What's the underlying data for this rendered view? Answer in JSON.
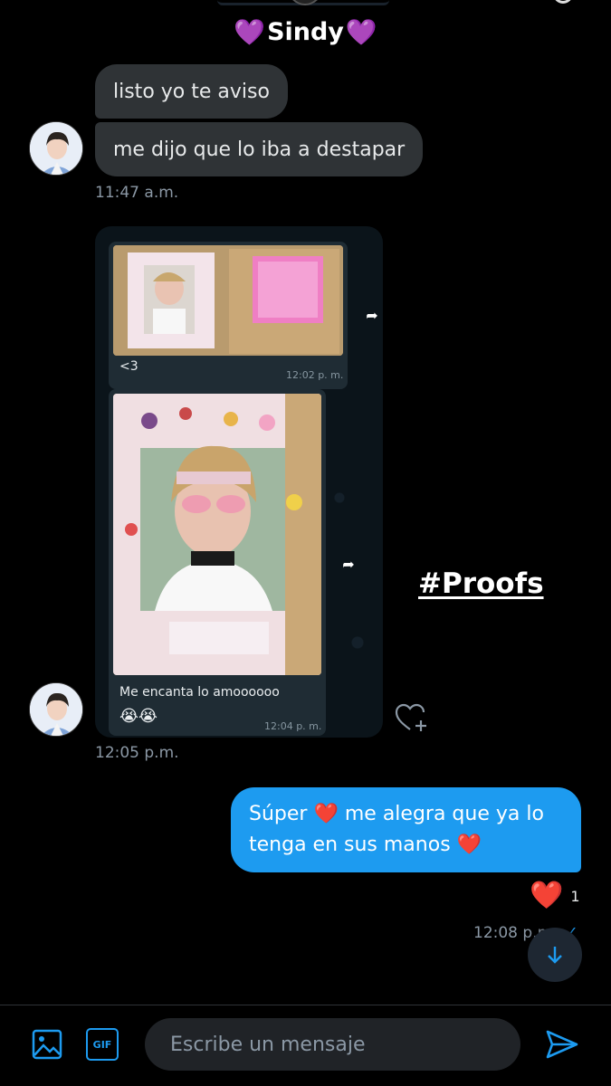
{
  "header": {
    "contact_name": "Sindy",
    "left_emoji": "💜",
    "right_emoji": "💜"
  },
  "messages": {
    "incoming_1": "listo yo te aviso",
    "incoming_2": "me dijo que lo iba a destapar",
    "time_1": "11:47 a.m.",
    "media_card": {
      "caption_1": "<3",
      "time_a": "12:02 p. m.",
      "caption_2": "Me encanta lo amoooooo",
      "emoji_2": "😭😭",
      "time_b": "12:04 p. m."
    },
    "overlay_text": "#Proofs",
    "time_2": "12:05 p.m.",
    "outgoing": {
      "part1": "Súper",
      "heart1": "❤️",
      "part2": "me alegra que ya lo tenga en sus manos",
      "heart2": "❤️"
    },
    "reaction": {
      "emoji": "❤️",
      "count": "1"
    },
    "sent_time": "12:08 p.m."
  },
  "composer": {
    "placeholder": "Escribe un mensaje",
    "gif_label": "GIF"
  },
  "colors": {
    "accent": "#1d9bf0",
    "bubble_in": "#2f3336",
    "heart": "#e0245e",
    "purple": "#a55cf0"
  }
}
